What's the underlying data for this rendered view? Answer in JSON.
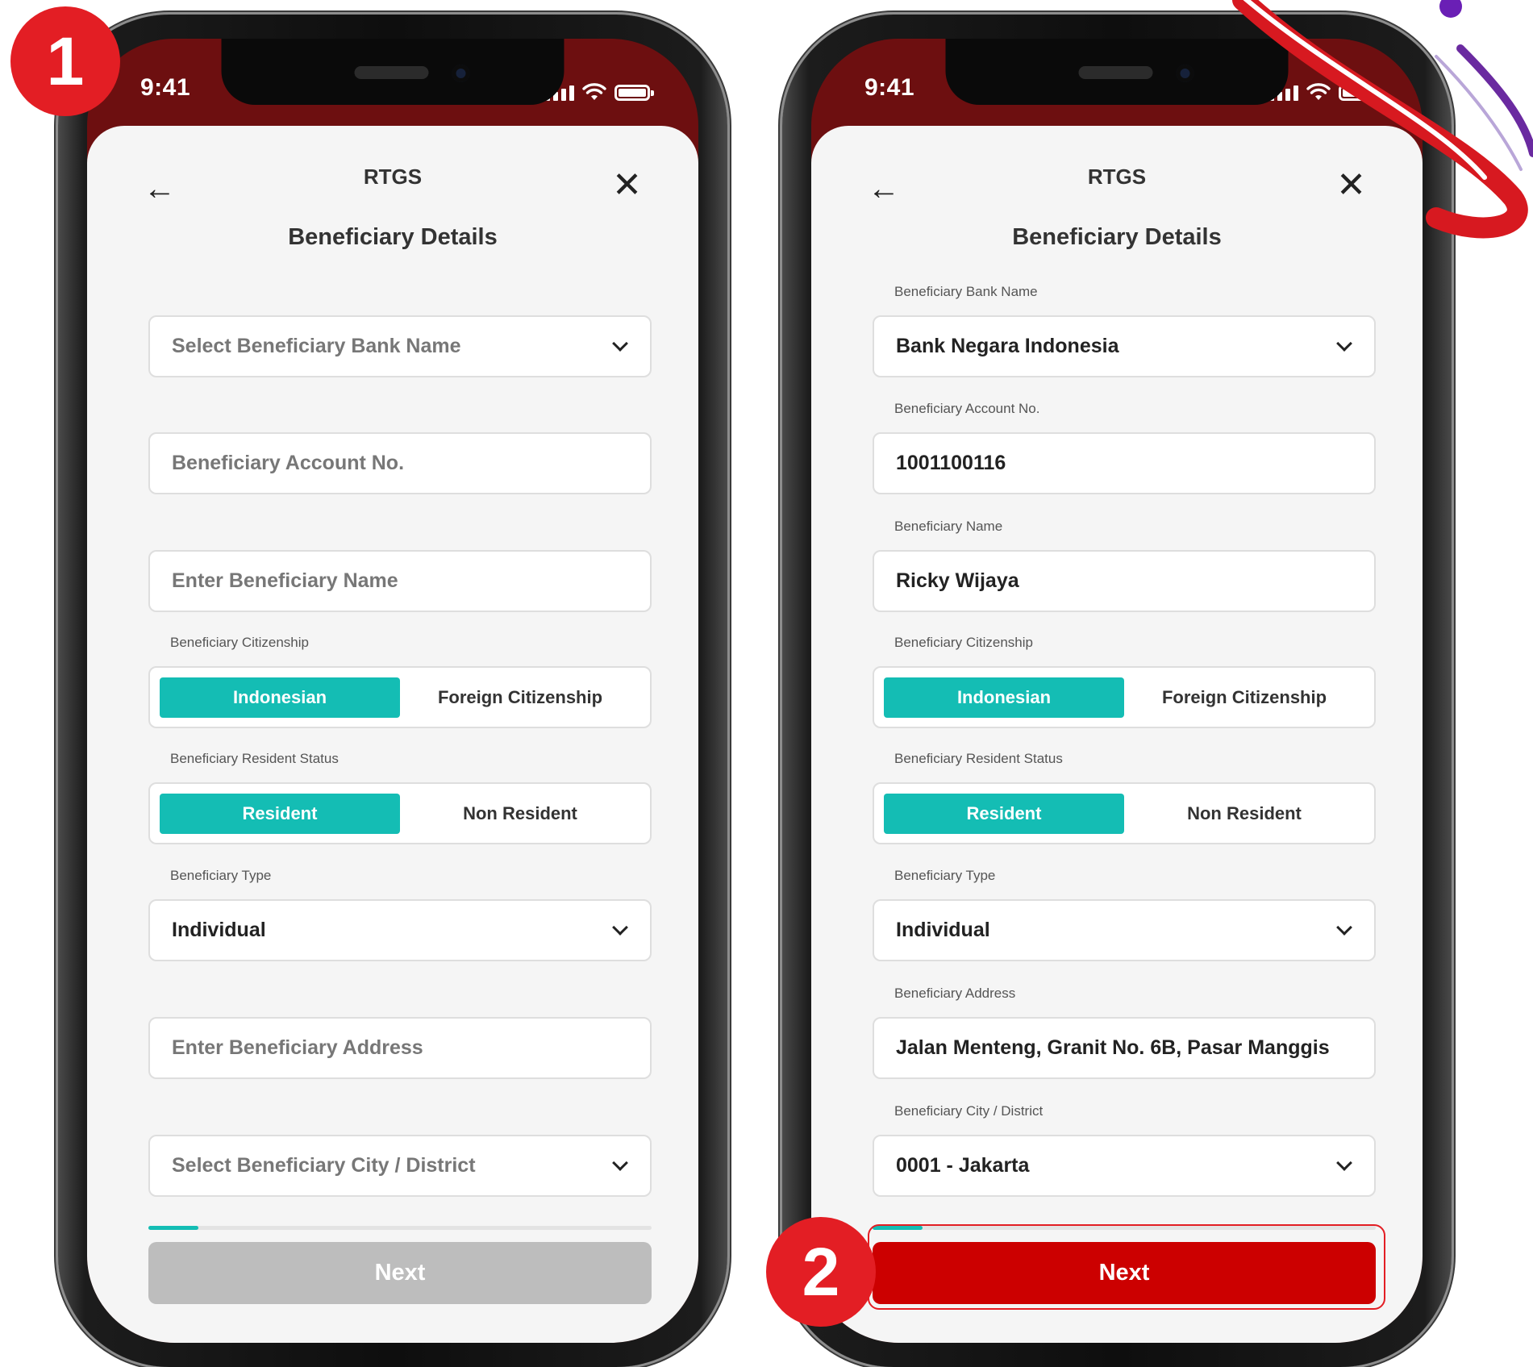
{
  "steps": [
    "1",
    "2"
  ],
  "colors": {
    "accent_teal": "#14bdb4",
    "brand_red": "#cc0000",
    "header_maroon": "#6d0f10"
  },
  "screens": [
    {
      "status": {
        "time": "9:41"
      },
      "header": {
        "title": "RTGS",
        "subtitle": "Beneficiary Details"
      },
      "fields": {
        "bank": {
          "label": "",
          "text": "Select Beneficiary Bank Name"
        },
        "account": {
          "label": "",
          "text": "Beneficiary Account No."
        },
        "name": {
          "label": "",
          "text": "Enter Beneficiary Name"
        },
        "citizenship": {
          "label": "Beneficiary Citizenship",
          "options": [
            "Indonesian",
            "Foreign Citizenship"
          ],
          "selected": "Indonesian"
        },
        "resident": {
          "label": "Beneficiary Resident Status",
          "options": [
            "Resident",
            "Non Resident"
          ],
          "selected": "Resident"
        },
        "type": {
          "label": "Beneficiary Type",
          "text": "Individual"
        },
        "address": {
          "label": "",
          "text": "Enter Beneficiary Address"
        },
        "city": {
          "label": "",
          "text": "Select Beneficiary City / District"
        }
      },
      "progress": 0.1,
      "next": {
        "label": "Next",
        "enabled": false
      }
    },
    {
      "status": {
        "time": "9:41"
      },
      "header": {
        "title": "RTGS",
        "subtitle": "Beneficiary Details"
      },
      "fields": {
        "bank": {
          "label": "Beneficiary Bank Name",
          "text": "Bank Negara Indonesia"
        },
        "account": {
          "label": "Beneficiary Account No.",
          "text": "1001100116"
        },
        "name": {
          "label": "Beneficiary Name",
          "text": "Ricky Wijaya"
        },
        "citizenship": {
          "label": "Beneficiary Citizenship",
          "options": [
            "Indonesian",
            "Foreign Citizenship"
          ],
          "selected": "Indonesian"
        },
        "resident": {
          "label": "Beneficiary Resident Status",
          "options": [
            "Resident",
            "Non Resident"
          ],
          "selected": "Resident"
        },
        "type": {
          "label": "Beneficiary Type",
          "text": "Individual"
        },
        "address": {
          "label": "Beneficiary Address",
          "text": "Jalan Menteng, Granit No. 6B, Pasar Manggis"
        },
        "city": {
          "label": "Beneficiary City / District",
          "text": "0001 - Jakarta"
        }
      },
      "progress": 0.1,
      "next": {
        "label": "Next",
        "enabled": true
      }
    }
  ]
}
